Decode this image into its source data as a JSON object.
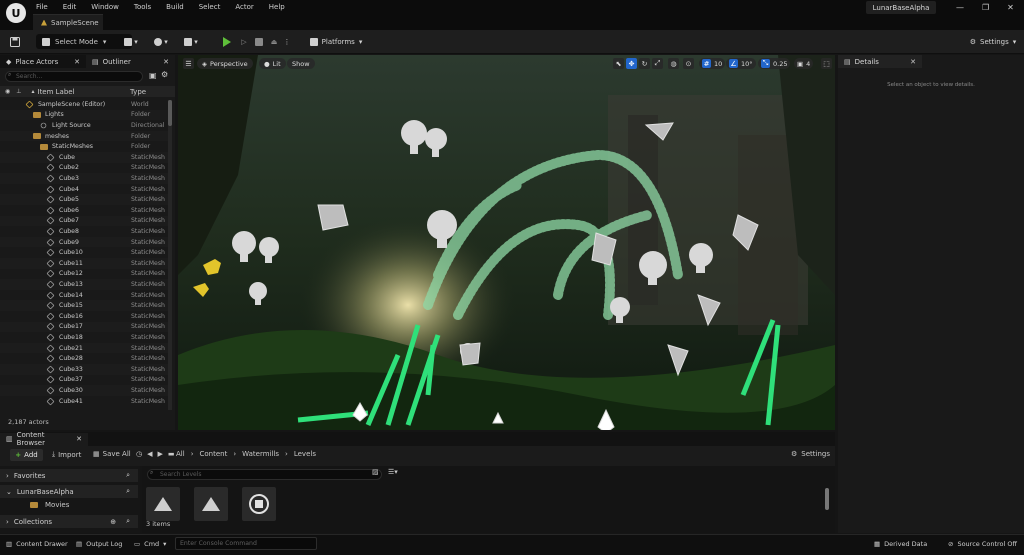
{
  "app": {
    "logo": "U",
    "menu": [
      "File",
      "Edit",
      "Window",
      "Tools",
      "Build",
      "Select",
      "Actor",
      "Help"
    ],
    "scene_tab": "SampleScene",
    "project_name": "LunarBaseAlpha",
    "window_controls": [
      "—",
      "❐",
      "✕"
    ]
  },
  "toolbar": {
    "select_mode": "Select Mode",
    "platforms": "Platforms",
    "settings": "Settings"
  },
  "outliner": {
    "tabs": [
      "Place Actors",
      "Outliner"
    ],
    "search_placeholder": "Search...",
    "columns": [
      "Item Label",
      "Type"
    ],
    "rows": [
      {
        "label": "SampleScene (Editor)",
        "type": "World",
        "indent": 0,
        "icon": "world-icon"
      },
      {
        "label": "Lights",
        "type": "Folder",
        "indent": 1,
        "icon": "folder-icon"
      },
      {
        "label": "Light Source",
        "type": "Directional",
        "indent": 2,
        "icon": "light-icon"
      },
      {
        "label": "meshes",
        "type": "Folder",
        "indent": 1,
        "icon": "folder-icon"
      },
      {
        "label": "StaticMeshes",
        "type": "Folder",
        "indent": 2,
        "icon": "folder-icon"
      },
      {
        "label": "Cube",
        "type": "StaticMesh",
        "indent": 3,
        "icon": "cube-icon"
      },
      {
        "label": "Cube2",
        "type": "StaticMesh",
        "indent": 3,
        "icon": "cube-icon"
      },
      {
        "label": "Cube3",
        "type": "StaticMesh",
        "indent": 3,
        "icon": "cube-icon"
      },
      {
        "label": "Cube4",
        "type": "StaticMesh",
        "indent": 3,
        "icon": "cube-icon"
      },
      {
        "label": "Cube5",
        "type": "StaticMesh",
        "indent": 3,
        "icon": "cube-icon"
      },
      {
        "label": "Cube6",
        "type": "StaticMesh",
        "indent": 3,
        "icon": "cube-icon"
      },
      {
        "label": "Cube7",
        "type": "StaticMesh",
        "indent": 3,
        "icon": "cube-icon"
      },
      {
        "label": "Cube8",
        "type": "StaticMesh",
        "indent": 3,
        "icon": "cube-icon"
      },
      {
        "label": "Cube9",
        "type": "StaticMesh",
        "indent": 3,
        "icon": "cube-icon"
      },
      {
        "label": "Cube10",
        "type": "StaticMesh",
        "indent": 3,
        "icon": "cube-icon"
      },
      {
        "label": "Cube11",
        "type": "StaticMesh",
        "indent": 3,
        "icon": "cube-icon"
      },
      {
        "label": "Cube12",
        "type": "StaticMesh",
        "indent": 3,
        "icon": "cube-icon"
      },
      {
        "label": "Cube13",
        "type": "StaticMesh",
        "indent": 3,
        "icon": "cube-icon"
      },
      {
        "label": "Cube14",
        "type": "StaticMesh",
        "indent": 3,
        "icon": "cube-icon"
      },
      {
        "label": "Cube15",
        "type": "StaticMesh",
        "indent": 3,
        "icon": "cube-icon"
      },
      {
        "label": "Cube16",
        "type": "StaticMesh",
        "indent": 3,
        "icon": "cube-icon"
      },
      {
        "label": "Cube17",
        "type": "StaticMesh",
        "indent": 3,
        "icon": "cube-icon"
      },
      {
        "label": "Cube18",
        "type": "StaticMesh",
        "indent": 3,
        "icon": "cube-icon"
      },
      {
        "label": "Cube21",
        "type": "StaticMesh",
        "indent": 3,
        "icon": "cube-icon"
      },
      {
        "label": "Cube28",
        "type": "StaticMesh",
        "indent": 3,
        "icon": "cube-icon"
      },
      {
        "label": "Cube33",
        "type": "StaticMesh",
        "indent": 3,
        "icon": "cube-icon"
      },
      {
        "label": "Cube37",
        "type": "StaticMesh",
        "indent": 3,
        "icon": "cube-icon"
      },
      {
        "label": "Cube30",
        "type": "StaticMesh",
        "indent": 3,
        "icon": "cube-icon"
      },
      {
        "label": "Cube41",
        "type": "StaticMesh",
        "indent": 3,
        "icon": "cube-icon"
      }
    ],
    "actor_count": "2,187 actors"
  },
  "viewport": {
    "perspective": "Perspective",
    "lit": "Lit",
    "show": "Show",
    "grid_size": "10",
    "rotation_snap": "10°",
    "scale_snap": "0.25",
    "camera_speed": "4"
  },
  "details": {
    "tab": "Details",
    "empty_message": "Select an object to view details."
  },
  "content_browser": {
    "tab": "Content Browser",
    "add": "Add",
    "import": "Import",
    "save_all": "Save All",
    "path": [
      "All",
      "Content",
      "Watermills",
      "Levels"
    ],
    "settings": "Settings",
    "sections": [
      "Favorites",
      "LunarBaseAlpha",
      "Collections"
    ],
    "folders": [
      "Movies"
    ],
    "search_placeholder": "Search Levels",
    "items_count": "3 items"
  },
  "statusbar": {
    "content_drawer": "Content Drawer",
    "output_log": "Output Log",
    "cmd": "Cmd",
    "console_placeholder": "Enter Console Command",
    "derived_data": "Derived Data",
    "source_control": "Source Control Off"
  },
  "colors": {
    "accent_blue": "#2266cc",
    "play_green": "#5fbf3a",
    "folder": "#b58a3a",
    "panel": "#191919"
  }
}
